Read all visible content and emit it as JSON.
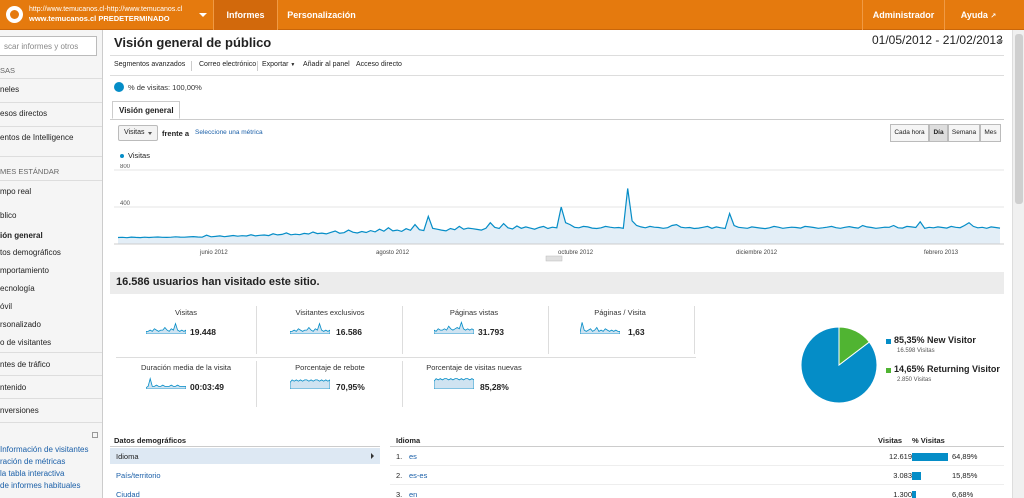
{
  "topbar": {
    "account_line1": "http://www.temucanos.cl-http://www.temucanos.cl",
    "account_line2": "www.temucanos.cl PREDETERMINADO",
    "tabs": [
      {
        "label": "Informes",
        "active": true
      },
      {
        "label": "Personalización",
        "active": false
      }
    ],
    "admin": "Administrador",
    "help": "Ayuda"
  },
  "sidebar": {
    "search_placeholder": "scar informes y otros",
    "items": [
      {
        "label": "SAS",
        "type": "head"
      },
      {
        "label": "neles",
        "type": "item"
      },
      {
        "label": "esos directos",
        "type": "item"
      },
      {
        "label": "entos de Intelligence",
        "type": "item"
      },
      {
        "label": "MES ESTÁNDAR",
        "type": "head"
      },
      {
        "label": "mpo real",
        "type": "item"
      },
      {
        "label": "blico",
        "type": "item"
      },
      {
        "label": "ión general",
        "type": "sel"
      },
      {
        "label": "tos demográficos",
        "type": "item"
      },
      {
        "label": "mportamiento",
        "type": "item"
      },
      {
        "label": "ecnología",
        "type": "item"
      },
      {
        "label": "óvil",
        "type": "item"
      },
      {
        "label": "rsonalizado",
        "type": "item"
      },
      {
        "label": "o de visitantes",
        "type": "item"
      },
      {
        "label": "ntes de tráfico",
        "type": "item"
      },
      {
        "label": "ntenido",
        "type": "item"
      },
      {
        "label": "nversiones",
        "type": "item"
      }
    ],
    "links": [
      "Información de visitantes",
      "ración de métricas",
      "la tabla interactiva",
      "de informes habituales"
    ]
  },
  "main": {
    "title": "Visión general de público",
    "date_range": "01/05/2012 - 21/02/2013",
    "toolbar": [
      "Segmentos avanzados",
      "Correo electrónico",
      "Exportar",
      "Añadir al panel",
      "Acceso directo"
    ],
    "pct_visits": "% de visitas: 100,00%",
    "tab": "Visión general",
    "metric": "Visitas",
    "vs": "frente a",
    "select_metric": "Seleccione una métrica",
    "granularity": [
      {
        "label": "Cada hora",
        "on": false
      },
      {
        "label": "Día",
        "on": true
      },
      {
        "label": "Semana",
        "on": false
      },
      {
        "label": "Mes",
        "on": false
      }
    ],
    "legend": "Visitas",
    "summary": "16.586 usuarios han visitado este sitio."
  },
  "chart_data": {
    "type": "area",
    "series": [
      {
        "name": "Visitas",
        "values": [
          70,
          72,
          68,
          75,
          71,
          69,
          74,
          70,
          73,
          76,
          72,
          71,
          74,
          78,
          75,
          73,
          77,
          80,
          76,
          74,
          95,
          78,
          82,
          88,
          79,
          85,
          92,
          84,
          90,
          86,
          100,
          88,
          94,
          97,
          91,
          110,
          98,
          104,
          120,
          99,
          106,
          101,
          115,
          108,
          130,
          112,
          118,
          109,
          125,
          140,
          117,
          122,
          150,
          128,
          119,
          135,
          124,
          145,
          131,
          160,
          138,
          175,
          142,
          150,
          136,
          165,
          148,
          210,
          155,
          145,
          300,
          170,
          160,
          150,
          142,
          168,
          155,
          190,
          160,
          172,
          165,
          158,
          150,
          170,
          230,
          180,
          168,
          220,
          175,
          162,
          195,
          170,
          185,
          172,
          160,
          178,
          190,
          168,
          182,
          175,
          400,
          230,
          210,
          180,
          175,
          190,
          185,
          172,
          168,
          175,
          190,
          182,
          175,
          178,
          170,
          600,
          250,
          200,
          185,
          175,
          190,
          182,
          178,
          170,
          176,
          200,
          210,
          182,
          175,
          178,
          168,
          172,
          180,
          190,
          170,
          185,
          175,
          168,
          330,
          200,
          180,
          175,
          170,
          185,
          178,
          172,
          166,
          175,
          190,
          182,
          170,
          176,
          182,
          178,
          172,
          190,
          185,
          178,
          170,
          175,
          182,
          190,
          176,
          170,
          180,
          188,
          178,
          172,
          200,
          185,
          178,
          170,
          175,
          182,
          180,
          200,
          175,
          172,
          190,
          185,
          178,
          240,
          170,
          180,
          175,
          185,
          178,
          172,
          190,
          180,
          176,
          200,
          230,
          190,
          175,
          180,
          170,
          185,
          178,
          172
        ]
      }
    ],
    "x_tick_labels": [
      "junio 2012",
      "agosto 2012",
      "octubre 2012",
      "diciembre 2012",
      "febrero 2013"
    ],
    "y_tick_labels": [
      "800",
      "400"
    ],
    "ylim": [
      0,
      800
    ],
    "grid": true
  },
  "stats": [
    {
      "label": "Visitas",
      "value": "19.448"
    },
    {
      "label": "Visitantes exclusivos",
      "value": "16.586"
    },
    {
      "label": "Páginas vistas",
      "value": "31.793"
    },
    {
      "label": "Páginas / Visita",
      "value": "1,63"
    },
    {
      "label": "Duración media de la visita",
      "value": "00:03:49"
    },
    {
      "label": "Porcentaje de rebote",
      "value": "70,95%"
    },
    {
      "label": "Porcentaje de visitas nuevas",
      "value": "85,28%"
    }
  ],
  "pie": {
    "new_pct": "85,35%",
    "new_label": "New Visitor",
    "new_sub": "16.598 Visitas",
    "new_color": "#058dc7",
    "new_share": 0.8535,
    "ret_pct": "14,65%",
    "ret_label": "Returning Visitor",
    "ret_sub": "2.850 Visitas",
    "ret_color": "#50b432"
  },
  "demographics": {
    "head": "Datos demográficos",
    "rows": [
      {
        "label": "Idioma",
        "selected": true
      },
      {
        "label": "País/territorio",
        "selected": false
      },
      {
        "label": "Ciudad",
        "selected": false
      }
    ]
  },
  "lang_table": {
    "col_lang": "Idioma",
    "col_visits": "Visitas",
    "col_pct": "% Visitas",
    "rows": [
      {
        "n": "1.",
        "lang": "es",
        "visits": "12.619",
        "pct": "64,89%",
        "share": 0.6489
      },
      {
        "n": "2.",
        "lang": "es-es",
        "visits": "3.083",
        "pct": "15,85%",
        "share": 0.1585
      },
      {
        "n": "3.",
        "lang": "en",
        "visits": "1.300",
        "pct": "6,68%",
        "share": 0.0668
      }
    ]
  }
}
